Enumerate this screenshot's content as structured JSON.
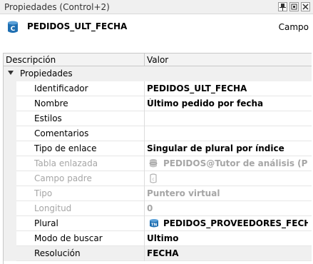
{
  "window": {
    "title": "Propiedades (Control+2)",
    "buttons": [
      "pin-icon",
      "restore-icon",
      "close-icon"
    ]
  },
  "header": {
    "icon": "control-c-icon",
    "name": "PEDIDOS_ULT_FECHA",
    "kind": "Campo"
  },
  "grid": {
    "columns": {
      "description": "Descripción",
      "value": "Valor"
    },
    "section": "Propiedades",
    "rows": [
      {
        "label": "Identificador",
        "value": "PEDIDOS_ULT_FECHA",
        "disabled": false
      },
      {
        "label": "Nombre",
        "value": "Último pedido por fecha",
        "disabled": false
      },
      {
        "label": "Estilos",
        "value": "",
        "disabled": false
      },
      {
        "label": "Comentarios",
        "value": "",
        "disabled": false
      },
      {
        "label": "Tipo de enlace",
        "value": "Singular de plural por índice",
        "disabled": false
      },
      {
        "label": "Tabla enlazada",
        "value": "PEDIDOS@Tutor de análisis (Proye...",
        "disabled": true,
        "icon": "database-icon"
      },
      {
        "label": "Campo padre",
        "value": "",
        "disabled": true,
        "icon": "field-icon"
      },
      {
        "label": "Tipo",
        "value": "Puntero virtual",
        "disabled": true
      },
      {
        "label": "Longitud",
        "value": "0",
        "disabled": true
      },
      {
        "label": "Plural",
        "value": "PEDIDOS_PROVEEDORES_FECHA",
        "disabled": false,
        "icon": "plural-icon"
      },
      {
        "label": "Modo de buscar",
        "value": "Ultimo",
        "disabled": false
      },
      {
        "label": "Resolución",
        "value": "FECHA",
        "disabled": false,
        "selected": true
      }
    ]
  },
  "colors": {
    "accent": "#1f6fb2",
    "disabled": "#a6a6a6"
  }
}
